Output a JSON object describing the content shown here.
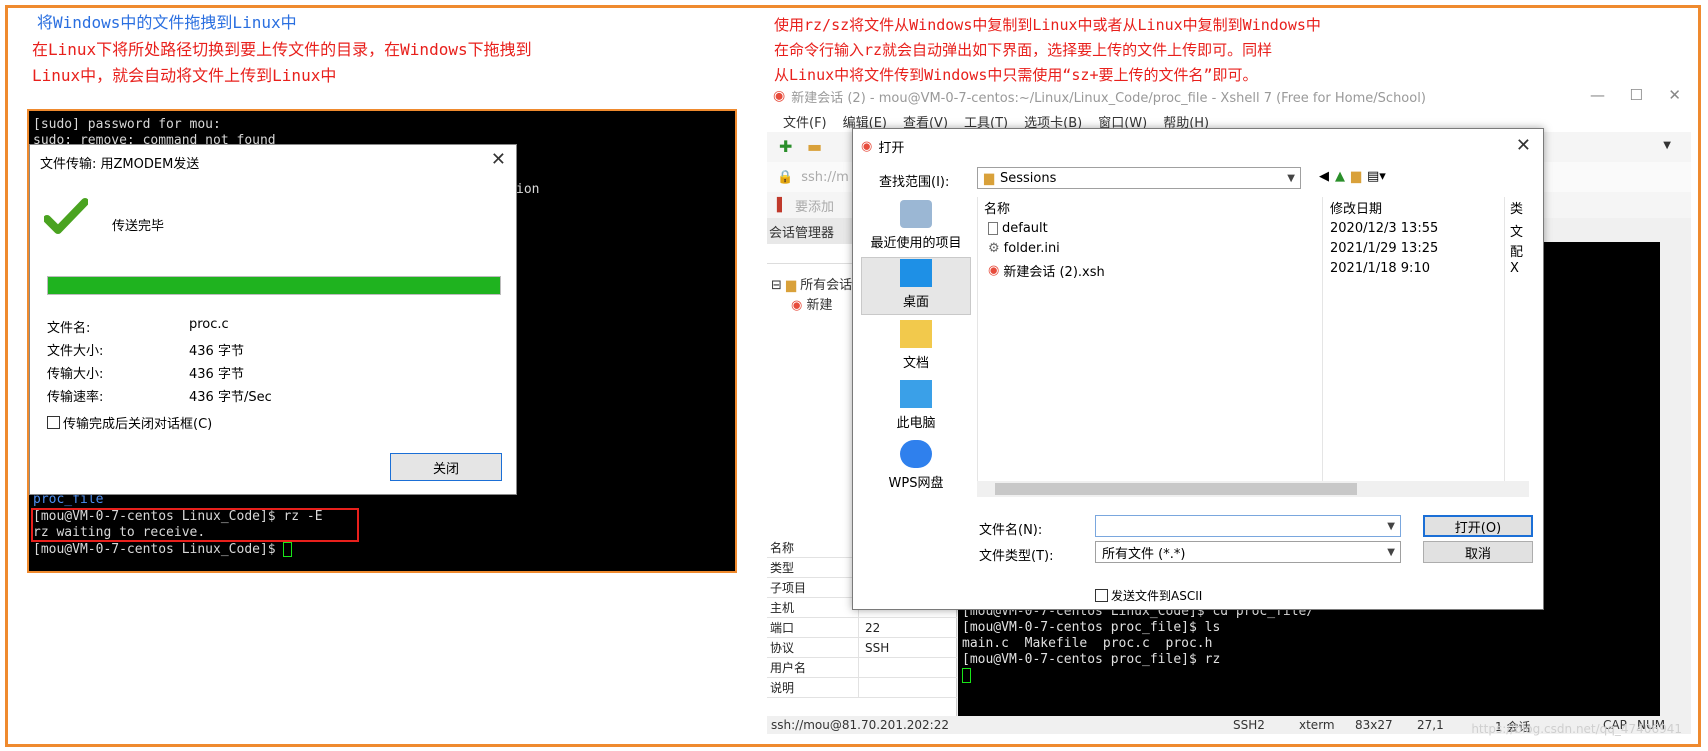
{
  "left_note": {
    "title": "将Windows中的文件拖拽到Linux中",
    "line1": "在Linux下将所处路径切换到要上传文件的目录，在Windows下拖拽到",
    "line2": "Linux中，就会自动将文件上传到Linux中"
  },
  "right_note": {
    "line1": "使用rz/sz将文件从Windows中复制到Linux中或者从Linux中复制到Windows中",
    "line2": "在命令行输入rz就会自动弹出如下界面，选择要上传的文件上传即可。同样",
    "line3": "从Linux中将文件传到Windows中只需使用“sz+要上传的文件名”即可。"
  },
  "left_terminal": {
    "lines": [
      "[sudo] password for mou:",
      "sudo: remove: command not found",
      "ion",
      "proc_file",
      "[mou@VM-0-7-centos Linux_Code]$ rz -E",
      "rz waiting to receive.",
      "[mou@VM-0-7-centos Linux_Code]$ "
    ]
  },
  "zmodem_dialog": {
    "title": "文件传输: 用ZMODEM发送",
    "status": "传送完毕",
    "progress": 1.0,
    "rows": [
      {
        "k": "文件名:",
        "v": "proc.c"
      },
      {
        "k": "文件大小:",
        "v": "436 字节"
      },
      {
        "k": "传输大小:",
        "v": "436 字节"
      },
      {
        "k": "传输速率:",
        "v": "436 字节/Sec"
      }
    ],
    "close_on_done": "传输完成后关闭对话框(C)",
    "close_button": "关闭"
  },
  "xshell": {
    "title": "新建会话 (2) - mou@VM-0-7-centos:~/Linux/Linux_Code/proc_file - Xshell 7 (Free for Home/School)",
    "menu": [
      "文件(F)",
      "编辑(E)",
      "查看(V)",
      "工具(T)",
      "选项卡(B)",
      "窗口(W)",
      "帮助(H)"
    ],
    "address": "ssh://m",
    "add_tip": "要添加",
    "session_manager": "会话管理器",
    "tree_root": "所有会话",
    "tree_child": "新建",
    "props": [
      {
        "k": "名称",
        "v": ""
      },
      {
        "k": "类型",
        "v": ""
      },
      {
        "k": "子项目",
        "v": ""
      },
      {
        "k": "主机",
        "v": ""
      },
      {
        "k": "端口",
        "v": "22"
      },
      {
        "k": "协议",
        "v": "SSH"
      },
      {
        "k": "用户名",
        "v": ""
      },
      {
        "k": "说明",
        "v": ""
      }
    ],
    "terminal": [
      "[mou@VM-0-7-centos Linux_Code]$ cd proc_file/",
      "[mou@VM-0-7-centos proc_file]$ ls",
      "main.c  Makefile  proc.c  proc.h",
      "[mou@VM-0-7-centos proc_file]$ rz"
    ],
    "status": {
      "addr": "ssh://mou@81.70.201.202:22",
      "proto": "SSH2",
      "term": "xterm",
      "size": "83x27",
      "pos": "27,1",
      "sessions": "1 会话",
      "cap": "CAP",
      "num": "NUM"
    }
  },
  "open_dialog": {
    "title": "打开",
    "lookin_label": "查找范围(I):",
    "lookin_value": "Sessions",
    "places": [
      "最近使用的项目",
      "桌面",
      "文档",
      "此电脑",
      "WPS网盘"
    ],
    "col_name": "名称",
    "col_date": "修改日期",
    "col_type": "类",
    "files": [
      {
        "name": "default",
        "date": "2020/12/3 13:55",
        "type": "文"
      },
      {
        "name": "folder.ini",
        "date": "2021/1/29 13:25",
        "type": "配"
      },
      {
        "name": "新建会话 (2).xsh",
        "date": "2021/1/18 9:10",
        "type": "X"
      }
    ],
    "filename_label": "文件名(N):",
    "filename_value": "",
    "filetype_label": "文件类型(T):",
    "filetype_value": "所有文件 (*.*)",
    "open_button": "打开(O)",
    "cancel_button": "取消",
    "ascii": "发送文件到ASCII"
  },
  "watermark": "https://blog.csdn.net/qq_47406941"
}
